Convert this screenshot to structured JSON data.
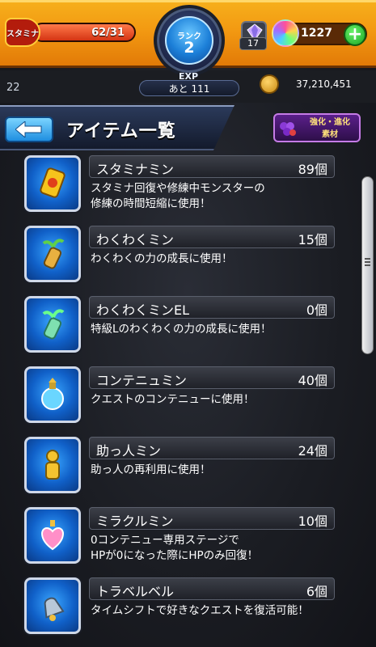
{
  "header": {
    "stamina_label": "スタミナ",
    "stamina_value": "62/31",
    "stamina_fill_fraction": 1.0,
    "rank_label": "ランク",
    "rank_value": "2",
    "exp_label": "EXP",
    "exp_remaining": "あと 111",
    "gem_count": "17",
    "orb_count": "1227",
    "plus_label": "+",
    "level_number": "22",
    "coin_count": "37,210,451"
  },
  "title_bar": {
    "title": "アイテム一覧",
    "evo_button_line1": "強化・進化",
    "evo_button_line2": "素材"
  },
  "items": [
    {
      "name": "スタミナミン",
      "count": "89個",
      "desc": "スタミナ回復や修練中モンスターの\n修練の時間短縮に使用！",
      "icon": "stamina-can-icon",
      "color": "#f6c41c"
    },
    {
      "name": "わくわくミン",
      "count": "15個",
      "desc": "わくわくの力の成長に使用！",
      "icon": "sprout-bottle-icon",
      "color": "#e8b040"
    },
    {
      "name": "わくわくミンEL",
      "count": "0個",
      "desc": "特級Lのわくわくの力の成長に使用！",
      "icon": "sprout-bottle-el-icon",
      "color": "#7ee0b0"
    },
    {
      "name": "コンテニュミン",
      "count": "40個",
      "desc": "クエストのコンテニューに使用！",
      "icon": "continue-potion-icon",
      "color": "#6ad6ff"
    },
    {
      "name": "助っ人ミン",
      "count": "24個",
      "desc": "助っ人の再利用に使用！",
      "icon": "helper-figure-icon",
      "color": "#f4c430"
    },
    {
      "name": "ミラクルミン",
      "count": "10個",
      "desc": "0コンテニュー専用ステージで\nHPが0になった際にHPのみ回復！",
      "icon": "heart-potion-icon",
      "color": "#ff8fc8"
    },
    {
      "name": "トラベルベル",
      "count": "6個",
      "desc": "タイムシフトで好きなクエストを復活可能！",
      "icon": "travel-bell-icon",
      "color": "#b8c8d8"
    }
  ]
}
